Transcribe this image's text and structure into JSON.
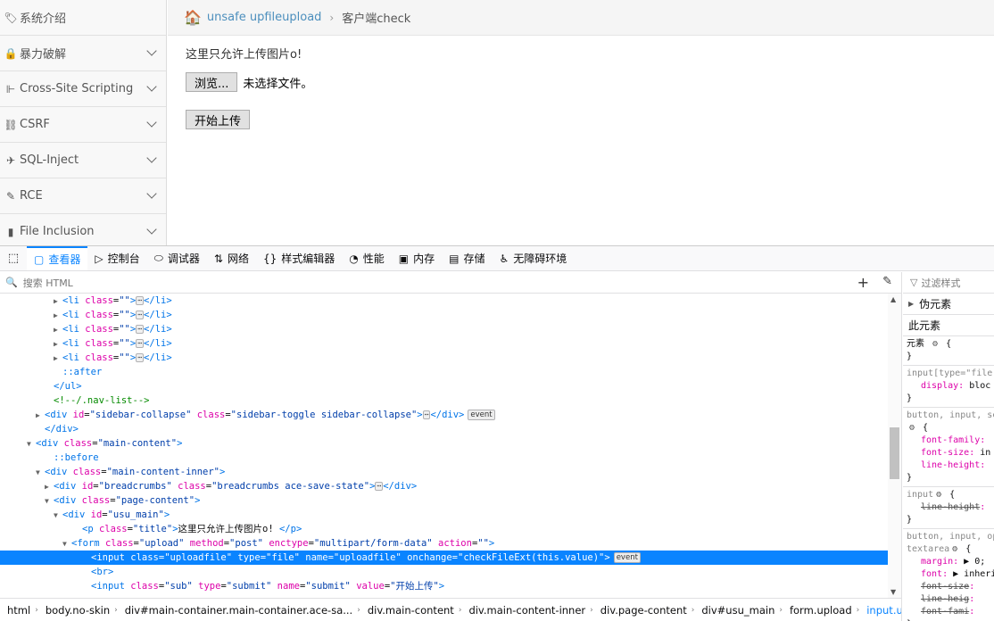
{
  "sidebar": {
    "items": [
      {
        "icon": "tag-icon",
        "glyph": "🏷",
        "label": "系统介绍",
        "chevron": false
      },
      {
        "icon": "lock-icon",
        "glyph": "🔒",
        "label": "暴力破解",
        "chevron": true
      },
      {
        "icon": "sitemap-icon",
        "glyph": "⊩",
        "label": "Cross-Site Scripting",
        "chevron": true
      },
      {
        "icon": "link-icon",
        "glyph": "⛓",
        "label": "CSRF",
        "chevron": true
      },
      {
        "icon": "plane-icon",
        "glyph": "✈",
        "label": "SQL-Inject",
        "chevron": true
      },
      {
        "icon": "pencil-icon",
        "glyph": "✎",
        "label": "RCE",
        "chevron": true
      },
      {
        "icon": "file-icon",
        "glyph": "▮",
        "label": "File Inclusion",
        "chevron": true
      }
    ]
  },
  "breadcrumbs": {
    "link": "unsafe upfileupload",
    "current": "客户端check"
  },
  "page": {
    "title": "这里只允许上传图片o!",
    "browse_label": "浏览...",
    "file_status": "未选择文件。",
    "upload_label": "开始上传"
  },
  "devtools": {
    "tabs": [
      {
        "icon": "inspector-icon",
        "glyph": "▢",
        "label": "查看器",
        "active": true
      },
      {
        "icon": "console-icon",
        "glyph": "▷",
        "label": "控制台",
        "active": false
      },
      {
        "icon": "debugger-icon",
        "glyph": "⬭",
        "label": "调试器",
        "active": false
      },
      {
        "icon": "network-icon",
        "glyph": "⇅",
        "label": "网络",
        "active": false
      },
      {
        "icon": "style-editor-icon",
        "glyph": "{}",
        "label": "样式编辑器",
        "active": false
      },
      {
        "icon": "performance-icon",
        "glyph": "◔",
        "label": "性能",
        "active": false
      },
      {
        "icon": "memory-icon",
        "glyph": "▣",
        "label": "内存",
        "active": false
      },
      {
        "icon": "storage-icon",
        "glyph": "▤",
        "label": "存储",
        "active": false
      },
      {
        "icon": "accessibility-icon",
        "glyph": "♿",
        "label": "无障碍环境",
        "active": false
      }
    ],
    "search_placeholder": "搜索 HTML",
    "rules_filter_placeholder": "过滤样式",
    "pseudo_label": "伪元素",
    "this_element_label": "此元素",
    "element_rule_label": "元素",
    "breadcrumbs": [
      {
        "tag": "html",
        "cls": ""
      },
      {
        "tag": "body",
        "cls": ".no-skin"
      },
      {
        "tag": "div",
        "cls": "#main-container.main-container.ace-sa..."
      },
      {
        "tag": "div",
        "cls": ".main-content"
      },
      {
        "tag": "div",
        "cls": ".main-content-inner"
      },
      {
        "tag": "div",
        "cls": ".page-content"
      },
      {
        "tag": "div",
        "cls": "#usu_main"
      },
      {
        "tag": "form",
        "cls": ".upload"
      },
      {
        "tag": "input",
        "cls": ".uploadfile"
      }
    ]
  },
  "tree": [
    {
      "indent": 60,
      "tw": "▶",
      "html": "<span class='tag'>&lt;li</span> <span class='attr'>class</span>=<span class='val'>\"\"</span><span class='tag'>&gt;</span><span class='dots'>⋯</span><span class='tag'>&lt;/li&gt;</span>"
    },
    {
      "indent": 60,
      "tw": "▶",
      "html": "<span class='tag'>&lt;li</span> <span class='attr'>class</span>=<span class='val'>\"\"</span><span class='tag'>&gt;</span><span class='dots'>⋯</span><span class='tag'>&lt;/li&gt;</span>"
    },
    {
      "indent": 60,
      "tw": "▶",
      "html": "<span class='tag'>&lt;li</span> <span class='attr'>class</span>=<span class='val'>\"\"</span><span class='tag'>&gt;</span><span class='dots'>⋯</span><span class='tag'>&lt;/li&gt;</span>"
    },
    {
      "indent": 60,
      "tw": "▶",
      "html": "<span class='tag'>&lt;li</span> <span class='attr'>class</span>=<span class='val'>\"\"</span><span class='tag'>&gt;</span><span class='dots'>⋯</span><span class='tag'>&lt;/li&gt;</span>"
    },
    {
      "indent": 60,
      "tw": "▶",
      "html": "<span class='tag'>&lt;li</span> <span class='attr'>class</span>=<span class='val'>\"\"</span><span class='tag'>&gt;</span><span class='dots'>⋯</span><span class='tag'>&lt;/li&gt;</span>"
    },
    {
      "indent": 60,
      "tw": "",
      "html": "<span class='pseudo'>::after</span>"
    },
    {
      "indent": 50,
      "tw": "",
      "html": "<span class='tag'>&lt;/ul&gt;</span>"
    },
    {
      "indent": 50,
      "tw": "",
      "html": "<span class='comment'>&lt;!--/.nav-list--&gt;</span>"
    },
    {
      "indent": 40,
      "tw": "▶",
      "html": "<span class='tag'>&lt;div</span> <span class='attr'>id</span>=<span class='val'>\"sidebar-collapse\"</span> <span class='attr'>class</span>=<span class='val'>\"sidebar-toggle sidebar-collapse\"</span><span class='tag'>&gt;</span><span class='dots'>⋯</span><span class='tag'>&lt;/div&gt;</span><span class='evt'>event</span>"
    },
    {
      "indent": 40,
      "tw": "",
      "html": "<span class='tag'>&lt;/div&gt;</span>"
    },
    {
      "indent": 30,
      "tw": "▼",
      "html": "<span class='tag'>&lt;div</span> <span class='attr'>class</span>=<span class='val'>\"main-content\"</span><span class='tag'>&gt;</span>"
    },
    {
      "indent": 50,
      "tw": "",
      "html": "<span class='pseudo'>::before</span>"
    },
    {
      "indent": 40,
      "tw": "▼",
      "html": "<span class='tag'>&lt;div</span> <span class='attr'>class</span>=<span class='val'>\"main-content-inner\"</span><span class='tag'>&gt;</span>"
    },
    {
      "indent": 50,
      "tw": "▶",
      "html": "<span class='tag'>&lt;div</span> <span class='attr'>id</span>=<span class='val'>\"breadcrumbs\"</span> <span class='attr'>class</span>=<span class='val'>\"breadcrumbs ace-save-state\"</span><span class='tag'>&gt;</span><span class='dots'>⋯</span><span class='tag'>&lt;/div&gt;</span>"
    },
    {
      "indent": 50,
      "tw": "▼",
      "html": "<span class='tag'>&lt;div</span> <span class='attr'>class</span>=<span class='val'>\"page-content\"</span><span class='tag'>&gt;</span>"
    },
    {
      "indent": 60,
      "tw": "▼",
      "html": "<span class='tag'>&lt;div</span> <span class='attr'>id</span>=<span class='val'>\"usu_main\"</span><span class='tag'>&gt;</span>"
    },
    {
      "indent": 82,
      "tw": "",
      "html": "<span class='tag'>&lt;p</span> <span class='attr'>class</span>=<span class='val'>\"title\"</span><span class='tag'>&gt;</span>这里只允许上传图片o! <span class='tag'>&lt;/p&gt;</span>"
    },
    {
      "indent": 70,
      "tw": "▼",
      "html": "<span class='tag'>&lt;form</span> <span class='attr'>class</span>=<span class='val'>\"upload\"</span> <span class='attr'>method</span>=<span class='val'>\"post\"</span> <span class='attr'>enctype</span>=<span class='val'>\"multipart/form-data\"</span> <span class='attr'>action</span>=<span class='val'>\"\"</span><span class='tag'>&gt;</span>"
    },
    {
      "indent": 92,
      "tw": "",
      "sel": true,
      "html": "<span class='tag'>&lt;input</span> <span class='attr'>class</span>=<span class='val'>\"uploadfile\"</span> <span class='attr'>type</span>=<span class='val'>\"file\"</span> <span class='attr'>name</span>=<span class='val'>\"uploadfile\"</span> <span class='attr'>onchange</span>=<span class='val'>\"checkFileExt(this.value)\"</span><span class='tag'>&gt;</span><span class='evt'>event</span>"
    },
    {
      "indent": 92,
      "tw": "",
      "html": "<span class='tag'>&lt;br&gt;</span>"
    },
    {
      "indent": 92,
      "tw": "",
      "html": "<span class='tag'>&lt;input</span> <span class='attr'>class</span>=<span class='val'>\"sub\"</span> <span class='attr'>type</span>=<span class='val'>\"submit\"</span> <span class='attr'>name</span>=<span class='val'>\"submit\"</span> <span class='attr'>value</span>=<span class='val'>\"开始上传\"</span><span class='tag'>&gt;</span>"
    }
  ],
  "rules": [
    {
      "selector": "input[type=\"file\"",
      "props": [
        {
          "name": "display",
          "value": "bloc",
          "strike": false
        }
      ]
    },
    {
      "selector": "button, input, se",
      "gear": true,
      "props": [
        {
          "name": "font-family",
          "value": "",
          "strike": false
        },
        {
          "name": "font-size",
          "value": "in",
          "strike": false
        },
        {
          "name": "line-height",
          "value": "",
          "strike": false
        }
      ]
    },
    {
      "selector": "input",
      "gear": true,
      "props": [
        {
          "name": "line-height",
          "value": "",
          "strike": true
        }
      ]
    },
    {
      "selector": "button, input, op",
      "selector2": "textarea",
      "gear": true,
      "props": [
        {
          "name": "margin",
          "value": "▶ 0;",
          "strike": false
        },
        {
          "name": "font",
          "value": "▶ inheri",
          "strike": false
        },
        {
          "name": "font-size",
          "value": "",
          "strike": true
        },
        {
          "name": "line-heig",
          "value": "",
          "strike": true
        },
        {
          "name": "font-fami",
          "value": "",
          "strike": true
        }
      ]
    }
  ]
}
